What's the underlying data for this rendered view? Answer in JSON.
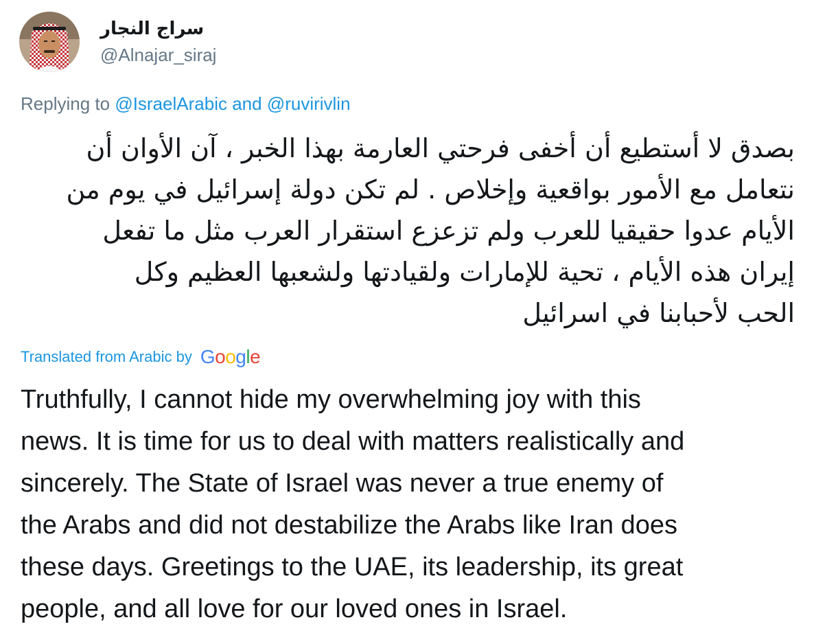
{
  "author": {
    "display_name": "سراج النجار",
    "handle": "@Alnajar_siraj",
    "avatar_icon": "user-avatar-photo"
  },
  "reply": {
    "prefix": "Replying to ",
    "mention1": "@IsraelArabic",
    "connector": " and ",
    "mention2": "@ruvirivlin"
  },
  "tweet": {
    "arabic_lines": [
      "بصدق لا أستطيع أن أخفى فرحتي العارمة بهذا الخبر ،  آن الأوان أن",
      "نتعامل مع الأمور بواقعية وإخلاص . لم تكن دولة إسرائيل  في يوم من",
      "الأيام عدوا حقيقيا للعرب ولم تزعزع استقرار العرب مثل ما تفعل",
      "إيران هذه الأيام ، تحية للإمارات ولقيادتها ولشعبها العظيم وكل",
      "الحب لأحبابنا في اسرائيل"
    ]
  },
  "translation": {
    "label": "Translated from Arabic by",
    "provider_letters": [
      "G",
      "o",
      "o",
      "g",
      "l",
      "e"
    ],
    "english_lines": [
      "Truthfully, I cannot hide my overwhelming joy with this",
      "news. It is time for us to deal with matters realistically and",
      "sincerely. The State of Israel was never a true enemy of",
      "the Arabs and did not destabilize the Arabs like Iran does",
      "these days. Greetings to the UAE, its leadership, its great",
      "people, and all love for our loved ones in Israel."
    ]
  },
  "colors": {
    "link": "#1b95e0",
    "secondary_text": "#657786",
    "primary_text": "#14171a"
  }
}
